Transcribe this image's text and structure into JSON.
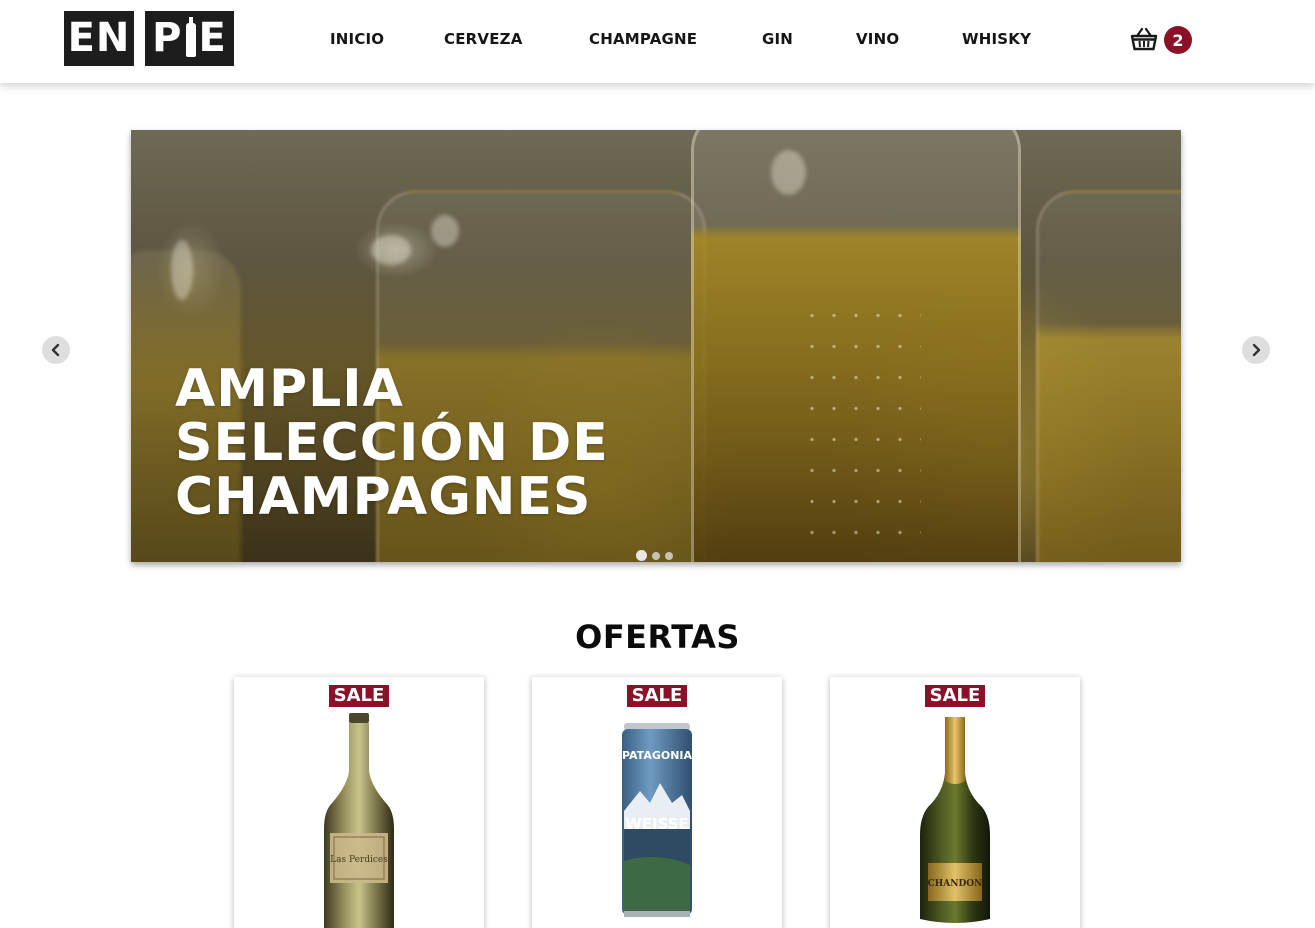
{
  "header": {
    "logo": {
      "part1": "EN",
      "part2_left": "P",
      "part2_right": "E"
    },
    "nav": [
      {
        "label": "INICIO"
      },
      {
        "label": "CERVEZA"
      },
      {
        "label": "CHAMPAGNE"
      },
      {
        "label": "GIN"
      },
      {
        "label": "VINO"
      },
      {
        "label": "WHISKY"
      }
    ],
    "cart": {
      "icon": "basket-icon",
      "count": "2"
    }
  },
  "carousel": {
    "headline": [
      "AMPLIA",
      "SELECCIÓN DE",
      "CHAMPAGNES"
    ],
    "slide_count": 3,
    "active_slide": 1,
    "prev_icon": "chevron-left-icon",
    "next_icon": "chevron-right-icon"
  },
  "offers": {
    "title": "OFERTAS",
    "products": [
      {
        "badge": "SALE",
        "image": "white-wine-bottle",
        "label_text": "Las Perdices"
      },
      {
        "badge": "SALE",
        "image": "beer-can",
        "label_text_top": "PATAGONIA",
        "label_text_main": "WEISSE"
      },
      {
        "badge": "SALE",
        "image": "champagne-bottle",
        "label_text": "CHANDON"
      }
    ]
  },
  "colors": {
    "accent": "#8a1127",
    "text": "#151515",
    "logo_bg": "#1d1d1d"
  }
}
